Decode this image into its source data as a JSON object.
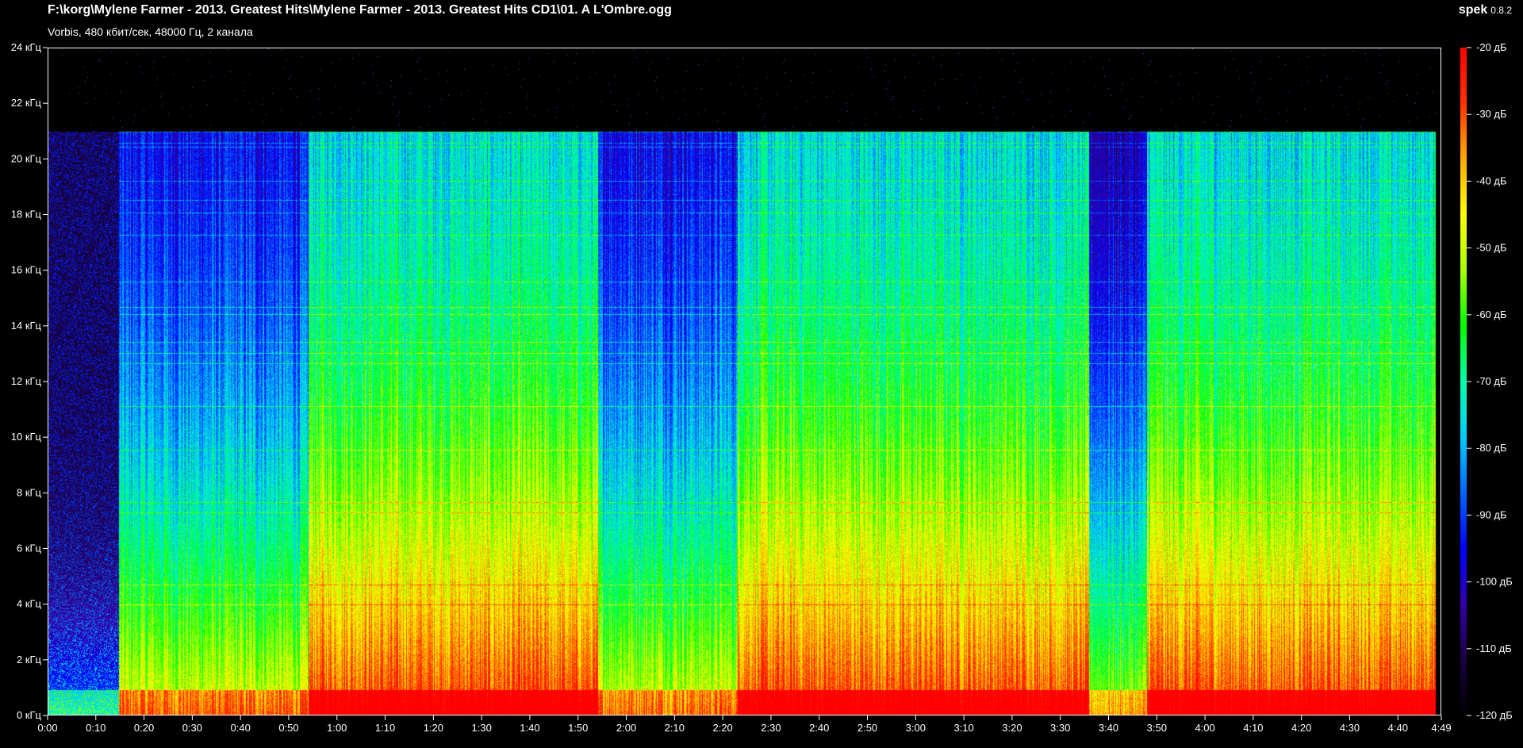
{
  "header": {
    "file_path": "F:\\korg\\Mylene Farmer - 2013. Greatest Hits\\Mylene Farmer - 2013. Greatest Hits CD1\\01. A L'Ombre.ogg",
    "stream_info": "Vorbis, 480 кбит/сек, 48000 Гц, 2 канала",
    "app_name": "spek",
    "app_version": "0.8.2"
  },
  "chart_data": {
    "type": "heatmap",
    "x_ticks": [
      "0:00",
      "0:10",
      "0:20",
      "0:30",
      "0:40",
      "0:50",
      "1:00",
      "1:10",
      "1:20",
      "1:30",
      "1:40",
      "1:50",
      "2:00",
      "2:10",
      "2:20",
      "2:30",
      "2:40",
      "2:50",
      "3:00",
      "3:10",
      "3:20",
      "3:30",
      "3:40",
      "3:50",
      "4:00",
      "4:10",
      "4:20",
      "4:30",
      "4:40",
      "4:49"
    ],
    "x_range_seconds": [
      0,
      289
    ],
    "y_ticks": [
      "0 кГц",
      "2 кГц",
      "4 кГц",
      "6 кГц",
      "8 кГц",
      "10 кГц",
      "12 кГц",
      "14 кГц",
      "16 кГц",
      "18 кГц",
      "20 кГц",
      "22 кГц",
      "24 кГц"
    ],
    "y_range_khz": [
      0,
      24
    ],
    "colorbar_ticks": [
      "-20 дБ",
      "-30 дБ",
      "-40 дБ",
      "-50 дБ",
      "-60 дБ",
      "-70 дБ",
      "-80 дБ",
      "-90 дБ",
      "-100 дБ",
      "-110 дБ",
      "-120 дБ"
    ],
    "colorbar_range_db": [
      -120,
      -20
    ],
    "colormap": [
      "#000000",
      "#1a0040",
      "#3300a8",
      "#0000ff",
      "#0066ff",
      "#00ccff",
      "#00ffaa",
      "#00ff00",
      "#aaff00",
      "#ffff00",
      "#ffaa00",
      "#ff3300",
      "#ff0000"
    ],
    "lowpass_cutoff_khz": 21,
    "segments": [
      {
        "start_s": 0,
        "end_s": 14.5,
        "profile": "sparse-low",
        "cutoff_khz": 21
      },
      {
        "start_s": 14.5,
        "end_s": 54,
        "profile": "moderate",
        "cutoff_khz": 21
      },
      {
        "start_s": 54,
        "end_s": 114,
        "profile": "dense",
        "cutoff_khz": 21
      },
      {
        "start_s": 114,
        "end_s": 143,
        "profile": "moderate",
        "cutoff_khz": 21
      },
      {
        "start_s": 143,
        "end_s": 216,
        "profile": "dense",
        "cutoff_khz": 21
      },
      {
        "start_s": 216,
        "end_s": 228,
        "profile": "thin",
        "cutoff_khz": 21
      },
      {
        "start_s": 228,
        "end_s": 288,
        "profile": "dense",
        "cutoff_khz": 21
      }
    ]
  }
}
